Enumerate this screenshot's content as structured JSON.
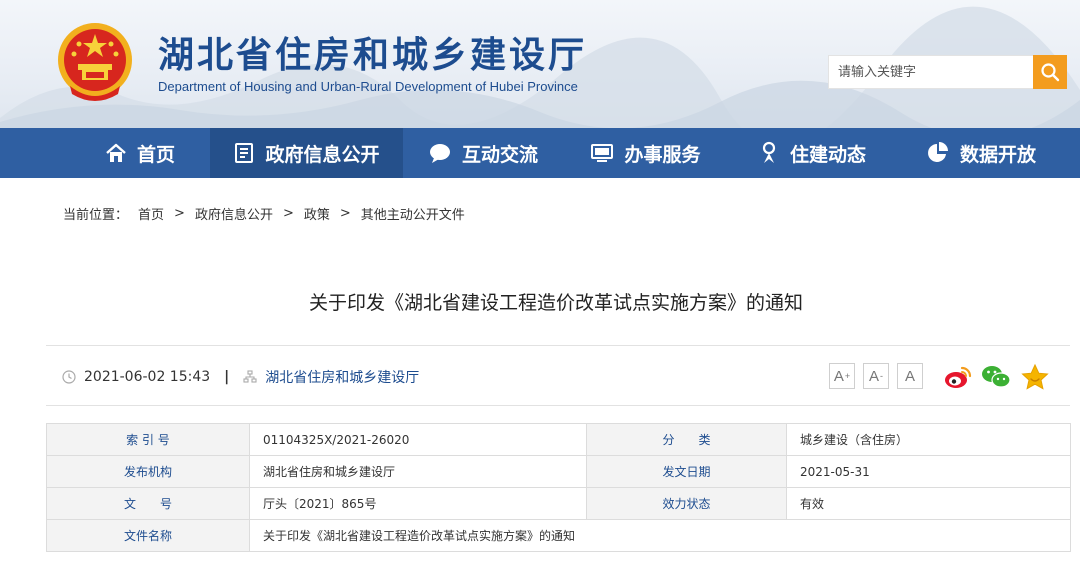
{
  "header": {
    "title": "湖北省住房和城乡建设厅",
    "subtitle": "Department of Housing and Urban-Rural Development of Hubei Province",
    "search_placeholder": "请输入关键字"
  },
  "nav": {
    "items": [
      {
        "label": "首页",
        "icon": "home-icon"
      },
      {
        "label": "政府信息公开",
        "icon": "document-icon",
        "active": true
      },
      {
        "label": "互动交流",
        "icon": "chat-icon"
      },
      {
        "label": "办事服务",
        "icon": "monitor-icon"
      },
      {
        "label": "住建动态",
        "icon": "person-icon"
      },
      {
        "label": "数据开放",
        "icon": "pie-chart-icon"
      }
    ]
  },
  "breadcrumb": {
    "label": "当前位置：",
    "items": [
      "首页",
      "政府信息公开",
      "政策",
      "其他主动公开文件"
    ],
    "separator": ">"
  },
  "article": {
    "title": "关于印发《湖北省建设工程造价改革试点实施方案》的通知",
    "datetime": "2021-06-02 15:43",
    "divider": "|",
    "source": "湖北省住房和城乡建设厅",
    "font_buttons": [
      "A",
      "A",
      "A"
    ],
    "font_marks": [
      "+",
      "-"
    ]
  },
  "info_table": {
    "rows": [
      {
        "k1": "索 引 号",
        "v1": "01104325X/2021-26020",
        "k2": "分　　类",
        "v2": "城乡建设（含住房）"
      },
      {
        "k1": "发布机构",
        "v1": "湖北省住房和城乡建设厅",
        "k2": "发文日期",
        "v2": "2021-05-31"
      },
      {
        "k1": "文　　号",
        "v1": "厅头〔2021〕865号",
        "k2": "效力状态",
        "v2": "有效"
      },
      {
        "k1": "文件名称",
        "v1": "关于印发《湖北省建设工程造价改革试点实施方案》的通知"
      }
    ]
  },
  "colors": {
    "brand_blue": "#2f5fa2",
    "nav_active": "#25508b",
    "title_blue": "#1d4c8f",
    "search_orange": "#f39c1e",
    "weibo": "#e6162d",
    "wechat": "#3cb034",
    "favorite": "#f5b400"
  }
}
